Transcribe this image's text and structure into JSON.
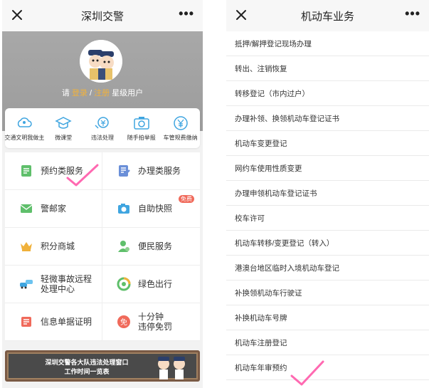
{
  "left": {
    "title": "深圳交警",
    "more": "•••",
    "login": {
      "prefix": "请",
      "login_link": "登录",
      "sep": "/",
      "register_link": "注册",
      "suffix": "星级用户"
    },
    "quick": [
      {
        "label": "交通文明我做主",
        "icon": "cloud-person-icon"
      },
      {
        "label": "微课堂",
        "icon": "graduation-cap-icon"
      },
      {
        "label": "违法处理",
        "icon": "hand-coin-icon"
      },
      {
        "label": "随手拍举报",
        "icon": "camera-icon"
      },
      {
        "label": "车管规费缴纳",
        "icon": "yen-icon"
      }
    ],
    "services": [
      {
        "label": "预约类服务",
        "icon": "document-icon",
        "color": "#5fbf6b"
      },
      {
        "label": "办理类服务",
        "icon": "edit-list-icon",
        "color": "#6a8fd8"
      },
      {
        "label": "警邮家",
        "icon": "envelope-icon",
        "color": "#5fbf6b"
      },
      {
        "label": "自助快照",
        "icon": "camera-icon",
        "color": "#3fa5e0",
        "badge": "免费"
      },
      {
        "label": "积分商城",
        "icon": "crown-icon",
        "color": "#f0b13a"
      },
      {
        "label": "便民服务",
        "icon": "person-icon",
        "color": "#5fbf6b"
      },
      {
        "label": "轻微事故远程处理中心",
        "label_l1": "轻微事故远程",
        "label_l2": "处理中心",
        "icon": "car-crash-icon",
        "color": "#3fa5e0"
      },
      {
        "label": "绿色出行",
        "icon": "recycle-icon",
        "color": "#5fbf6b"
      },
      {
        "label": "信息单据证明",
        "icon": "receipt-icon",
        "color": "#f06a5b"
      },
      {
        "label": "十分钟违停免罚",
        "label_l1": "十分钟",
        "label_l2": "违停免罚",
        "icon": "no-parking-icon",
        "color": "#f06a5b",
        "icon_text": "免"
      }
    ],
    "ad": {
      "line1": "深圳交警各大队违法处理窗口",
      "line2": "工作时间一览表"
    }
  },
  "right": {
    "title": "机动车业务",
    "more": "•••",
    "items": [
      "抵押/解押登记现场办理",
      "转出、注销恢复",
      "转移登记（市内过户）",
      "办理补领、换领机动车登记证书",
      "机动车变更登记",
      "网约车使用性质变更",
      "办理申领机动车登记证书",
      "校车许可",
      "机动车转移/变更登记（转入）",
      "港澳台地区临时入境机动车登记",
      "补换领机动车行驶证",
      "补换机动车号牌",
      "机动车注册登记",
      "机动车年审预约"
    ]
  },
  "colors": {
    "highlight_check": "#ff4fa3",
    "accent_orange": "#f2b23b"
  }
}
